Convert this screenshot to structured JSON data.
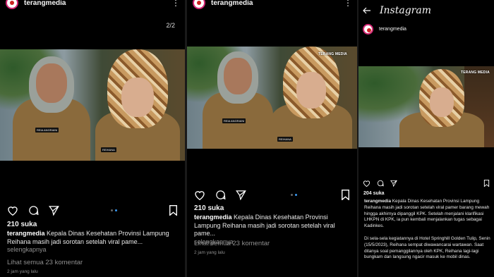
{
  "panel1": {
    "username": "terangmedia",
    "counter": "2/2",
    "likes": "210 suka",
    "caption_user": "terangmedia",
    "caption_text": "Kepala Dinas Kesehatan Provinsi Lampung Reihana masih jadi sorotan setelah viral pame...",
    "more": "selengkapnya",
    "comments": "Lihat semua 23 komentar",
    "time": "2 jam yang lalu",
    "name_tag_left": "REIA ANGRAINI",
    "name_tag_right": "REIHANA"
  },
  "panel2": {
    "username": "terangmedia",
    "watermark": "TERANG MEDIA",
    "likes": "210 suka",
    "caption_user": "terangmedia",
    "caption_text": "Kepala Dinas Kesehatan Provinsi Lampung Reihana masih jadi sorotan setelah viral pame...",
    "more": "selengkapnya",
    "comments": "Lihat semua 23 komentar",
    "time": "2 jam yang lalu",
    "name_tag_left": "REIA ANGRAINI",
    "name_tag_right": "REIHANA"
  },
  "panel3": {
    "app_title": "Instagram",
    "username": "terangmedia",
    "watermark": "TERANG MEDIA",
    "likes": "204 suka",
    "caption_user": "terangmedia",
    "caption_p1": "Kepala Dinas Kesehatan Provinsi Lampung Reihana masih jadi sorotan setelah viral pamer barang mewah hingga akhirnya dipanggil KPK. Setelah menjalani klarifikasi LHKPN di KPK, ia pun kembali menjalankan tugas sebagai Kadinkes.",
    "caption_p2": "Di sela-sela kegiatannya di Hotel Springhill Golden Tulip, Senin (15/5/2023), Reihana sempat diwawancarai wartawan. Saat ditanya soal pemanggilannya oleh KPK, Reihana lagi-lagi bungkam dan langsung ngacir masuk ke mobil dinas."
  },
  "icons": [
    "avatar-ring",
    "kebab-menu-icon",
    "heart-icon",
    "comment-icon",
    "share-icon",
    "bookmark-icon",
    "back-arrow-icon"
  ],
  "colors": {
    "background": "#000000",
    "accent_dot": "#3897f0",
    "muted_text": "#8e8e8e",
    "story_ring": "#d62976"
  }
}
